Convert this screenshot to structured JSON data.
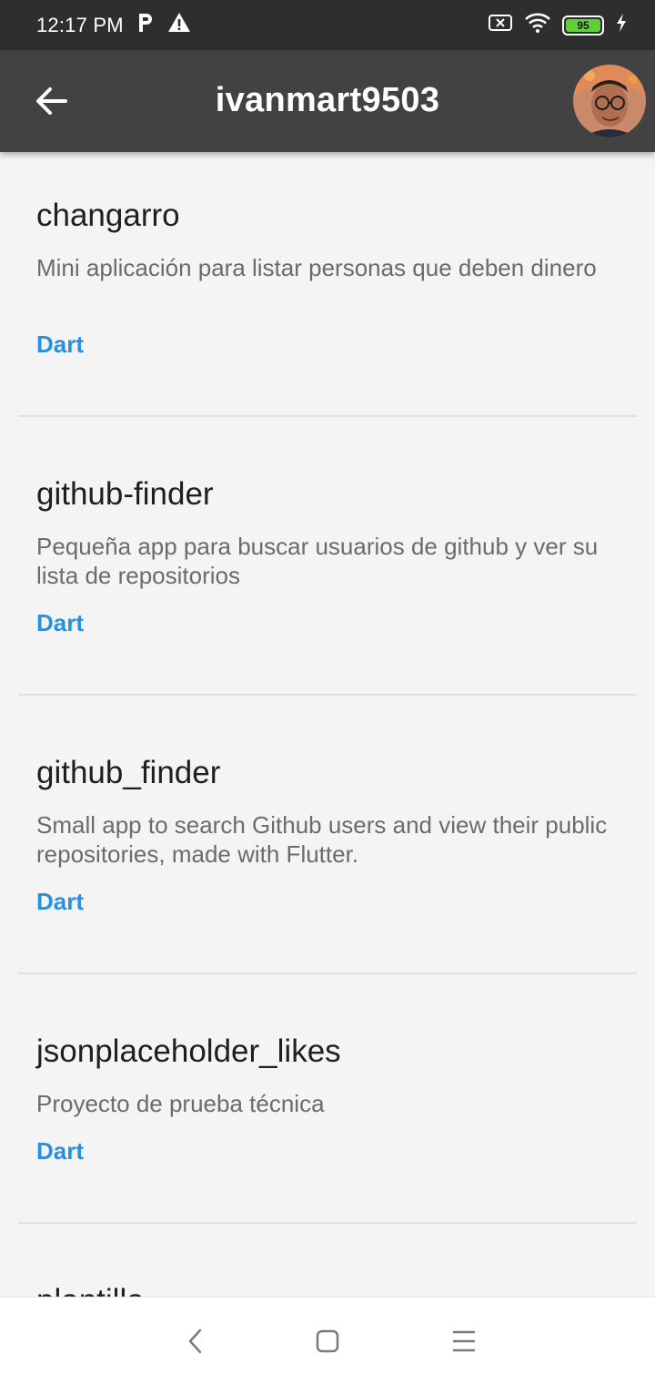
{
  "status_bar": {
    "time": "12:17 PM",
    "left_icons": [
      "parking-icon",
      "warning-icon"
    ],
    "right_icons": [
      "no-sim-icon",
      "wifi-icon",
      "battery-icon",
      "charging-icon"
    ],
    "battery_level": "95"
  },
  "app_bar": {
    "title": "ivanmart9503",
    "back_icon": "arrow-back-icon",
    "avatar": "user-avatar"
  },
  "repos": [
    {
      "name": "changarro",
      "description": "Mini aplicación para listar personas que deben dinero",
      "language": "Dart"
    },
    {
      "name": "github-finder",
      "description": "Pequeña app para buscar usuarios de github y ver su lista de repositorios",
      "language": "Dart"
    },
    {
      "name": "github_finder",
      "description": "Small app to search Github users and view their public repositories, made with Flutter.",
      "language": "Dart"
    },
    {
      "name": "jsonplaceholder_likes",
      "description": "Proyecto de prueba técnica",
      "language": "Dart"
    },
    {
      "name": "plantilla",
      "description": "",
      "language": ""
    }
  ],
  "nav_bar": {
    "icons": [
      "nav-back-icon",
      "nav-home-icon",
      "nav-menu-icon"
    ]
  },
  "colors": {
    "status_bar": "#2e2e2e",
    "app_bar": "#424242",
    "background": "#f4f4f4",
    "language": "#2b8fe0",
    "battery": "#5fcf3a"
  }
}
